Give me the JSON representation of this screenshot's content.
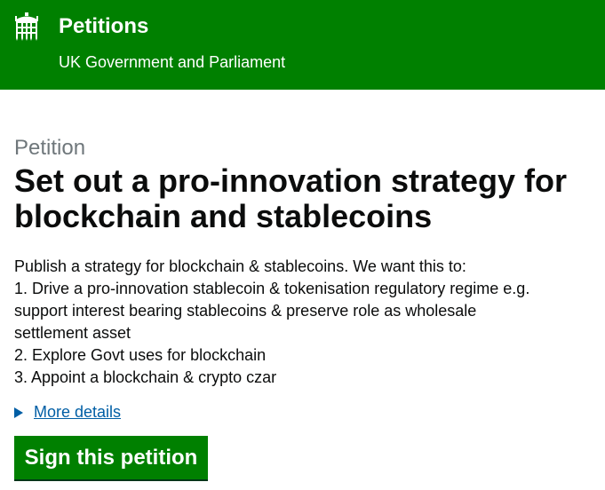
{
  "header": {
    "site_title": "Petitions",
    "site_subtitle": "UK Government and Parliament",
    "logo_icon": "portcullis-icon",
    "background_color": "#008000"
  },
  "main": {
    "caption": "Petition",
    "title": "Set out a pro-innovation strategy for blockchain and stablecoins",
    "description_lines": [
      "Publish a strategy for blockchain & stablecoins. We want this to:",
      "1. Drive a pro-innovation stablecoin & tokenisation regulatory regime e.g.",
      "support interest bearing stablecoins & preserve role as wholesale",
      "settlement asset",
      "2. Explore Govt uses for blockchain",
      "3. Appoint a blockchain & crypto czar"
    ],
    "more_details_label": "More details",
    "sign_button_label": "Sign this petition"
  },
  "colors": {
    "brand_green": "#008000",
    "link_blue": "#005ea5",
    "caption_grey": "#6f777b",
    "text": "#0b0c0c"
  }
}
